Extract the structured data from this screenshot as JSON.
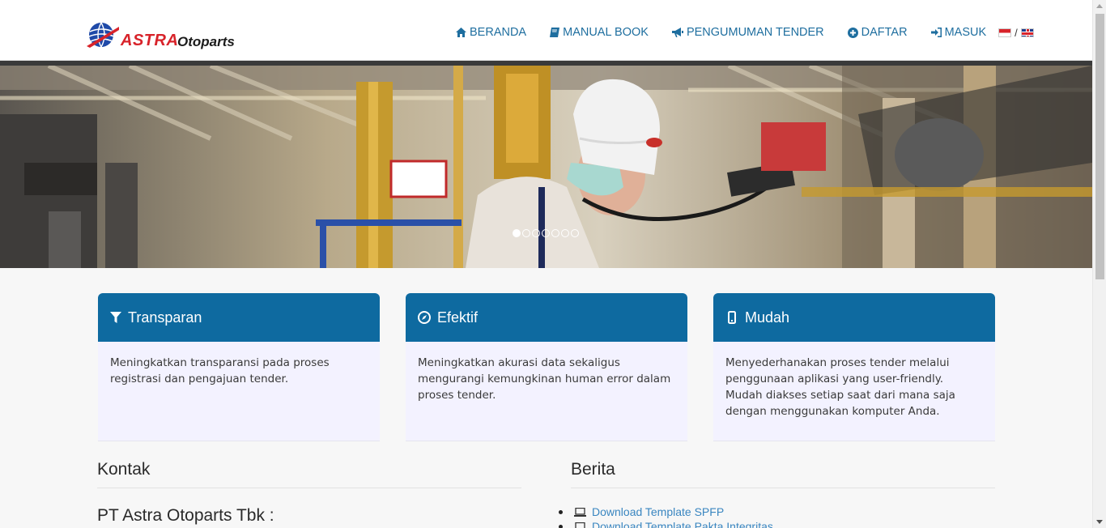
{
  "brand": {
    "logo_word1": "ASTRA",
    "logo_word2": "Otoparts",
    "logo_red": "#d8232a",
    "accent": "#0e6aa0"
  },
  "nav": {
    "items": [
      {
        "label": "BERANDA",
        "icon": "home-icon"
      },
      {
        "label": "MANUAL BOOK",
        "icon": "book-icon"
      },
      {
        "label": "PENGUMUMAN TENDER",
        "icon": "bullhorn-icon"
      },
      {
        "label": "DAFTAR",
        "icon": "plus-circle-icon"
      },
      {
        "label": "MASUK",
        "icon": "sign-in-icon"
      }
    ],
    "lang_separator": "/"
  },
  "hero": {
    "slides_total": 7,
    "active_slide": 1
  },
  "features": [
    {
      "title": "Transparan",
      "icon": "filter-icon",
      "text": "Meningkatkan transparansi pada proses registrasi dan pengajuan tender."
    },
    {
      "title": "Efektif",
      "icon": "compass-icon",
      "text": "Meningkatkan akurasi data sekaligus mengurangi kemungkinan human error dalam proses tender."
    },
    {
      "title": "Mudah",
      "icon": "mobile-icon",
      "text": "Menyederhanakan proses tender melalui penggunaan aplikasi yang user-friendly. Mudah diakses setiap saat dari mana saja dengan menggunakan komputer Anda."
    }
  ],
  "contact": {
    "heading": "Kontak",
    "company": "PT Astra Otoparts Tbk :"
  },
  "news": {
    "heading": "Berita",
    "items": [
      {
        "label": "Download Template SPFP"
      },
      {
        "label": "Download Template Pakta Integritas"
      }
    ]
  }
}
